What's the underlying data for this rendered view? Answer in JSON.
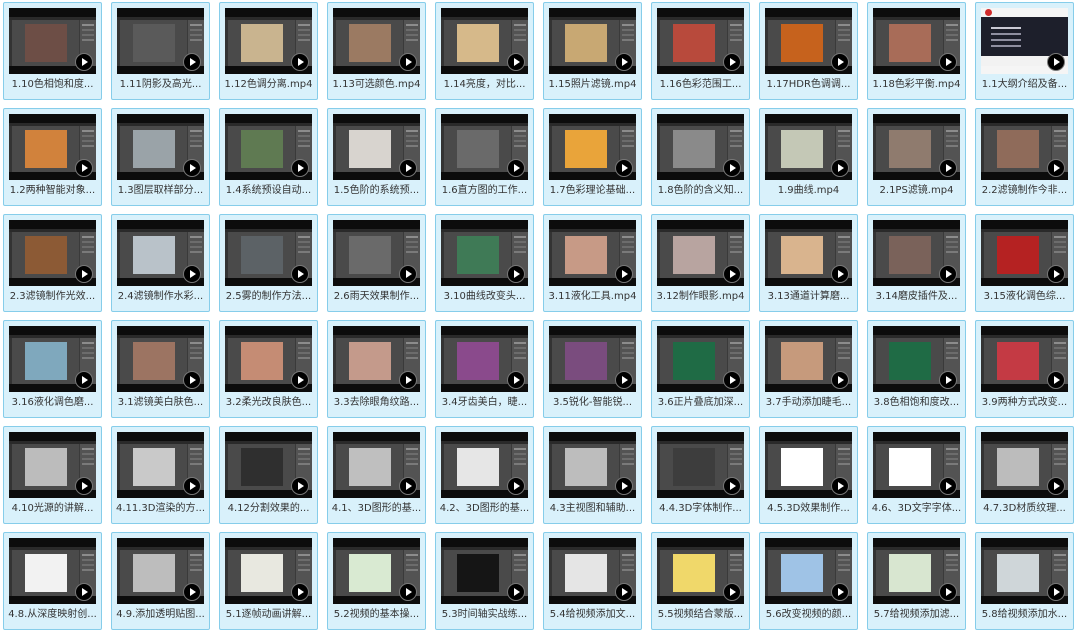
{
  "videos": [
    {
      "label": "1.10色相饱和度...",
      "color": "#6d4e46"
    },
    {
      "label": "1.11阴影及高光...",
      "color": "#5a5a5a"
    },
    {
      "label": "1.12色调分离.mp4",
      "color": "#c9b48f"
    },
    {
      "label": "1.13可选颜色.mp4",
      "color": "#9b7a62"
    },
    {
      "label": "1.14亮度，对比...",
      "color": "#d6b98a"
    },
    {
      "label": "1.15照片滤镜.mp4",
      "color": "#c8a873"
    },
    {
      "label": "1.16色彩范围工...",
      "color": "#b84a3c"
    },
    {
      "label": "1.17HDR色调调...",
      "color": "#c6621d"
    },
    {
      "label": "1.18色彩平衡.mp4",
      "color": "#a86c58"
    },
    {
      "label": "1.1大纲介绍及备...",
      "color": "#1d1f2b"
    },
    {
      "label": "1.2两种智能对象...",
      "color": "#d1823c"
    },
    {
      "label": "1.3图层取样部分...",
      "color": "#9aa3a8"
    },
    {
      "label": "1.4系统预设自动...",
      "color": "#5f7a52"
    },
    {
      "label": "1.5色阶的系统预...",
      "color": "#d8d4cf"
    },
    {
      "label": "1.6直方图的工作...",
      "color": "#6a6a6a"
    },
    {
      "label": "1.7色彩理论基础...",
      "color": "#e9a43a"
    },
    {
      "label": "1.8色阶的含义知...",
      "color": "#8a8a8a"
    },
    {
      "label": "1.9曲线.mp4",
      "color": "#c4c8b6"
    },
    {
      "label": "2.1PS滤镜.mp4",
      "color": "#8f7b6e"
    },
    {
      "label": "2.2滤镜制作今非...",
      "color": "#8f6b5a"
    },
    {
      "label": "2.3滤镜制作光效...",
      "color": "#8c5a35"
    },
    {
      "label": "2.4滤镜制作水彩...",
      "color": "#b9c2c9"
    },
    {
      "label": "2.5雾的制作方法...",
      "color": "#5c6266"
    },
    {
      "label": "2.6雨天效果制作...",
      "color": "#6a6a6a"
    },
    {
      "label": "3.10曲线改变头...",
      "color": "#3f7a56"
    },
    {
      "label": "3.11液化工具.mp4",
      "color": "#c79a86"
    },
    {
      "label": "3.12制作眼影.mp4",
      "color": "#b8a4a0"
    },
    {
      "label": "3.13通道计算磨...",
      "color": "#d9b48e"
    },
    {
      "label": "3.14磨皮插件及...",
      "color": "#7a625a"
    },
    {
      "label": "3.15液化调色综...",
      "color": "#b52222"
    },
    {
      "label": "3.16液化调色磨...",
      "color": "#7fa8bd"
    },
    {
      "label": "3.1滤镜美白肤色...",
      "color": "#9c7462"
    },
    {
      "label": "3.2柔光改良肤色...",
      "color": "#c58c74"
    },
    {
      "label": "3.3去除眼角纹路...",
      "color": "#c49a8b"
    },
    {
      "label": "3.4牙齿美白，睫...",
      "color": "#8a4a8c"
    },
    {
      "label": "3.5锐化-智能锐...",
      "color": "#7a4c7e"
    },
    {
      "label": "3.6正片叠底加深...",
      "color": "#1f6b45"
    },
    {
      "label": "3.7手动添加睫毛...",
      "color": "#c69a7c"
    },
    {
      "label": "3.8色相饱和度改...",
      "color": "#1f6b45"
    },
    {
      "label": "3.9两种方式改变...",
      "color": "#c43a44"
    },
    {
      "label": "4.10光源的讲解...",
      "color": "#bcbcbc"
    },
    {
      "label": "4.11.3D渲染的方...",
      "color": "#c9c9c9"
    },
    {
      "label": "4.12分割效果的...",
      "color": "#2f2f2f"
    },
    {
      "label": "4.1、3D图形的基...",
      "color": "#bfbfbf"
    },
    {
      "label": "4.2、3D图形的基...",
      "color": "#e6e6e6"
    },
    {
      "label": "4.3主视图和辅助...",
      "color": "#bdbdbd"
    },
    {
      "label": "4.4.3D字体制作...",
      "color": "#3d3d3d"
    },
    {
      "label": "4.5.3D效果制作...",
      "color": "#ffffff"
    },
    {
      "label": "4.6、3D文字字体...",
      "color": "#ffffff"
    },
    {
      "label": "4.7.3D材质纹理...",
      "color": "#bcbcbc"
    },
    {
      "label": "4.8.从深度映射创...",
      "color": "#f2f2f2"
    },
    {
      "label": "4.9.添加透明贴图...",
      "color": "#bdbdbd"
    },
    {
      "label": "5.1逐帧动画讲解...",
      "color": "#e8e8e0"
    },
    {
      "label": "5.2视频的基本操...",
      "color": "#d9ead2"
    },
    {
      "label": "5.3时间轴实战练...",
      "color": "#151515"
    },
    {
      "label": "5.4给视频添加文...",
      "color": "#e5e5e5"
    },
    {
      "label": "5.5视频结合蒙版...",
      "color": "#f0d86a"
    },
    {
      "label": "5.6改变视频的颜...",
      "color": "#9fc3e6"
    },
    {
      "label": "5.7给视频添加滤...",
      "color": "#d8e6d0"
    },
    {
      "label": "5.8给视频添加水...",
      "color": "#cfd6d9"
    }
  ]
}
